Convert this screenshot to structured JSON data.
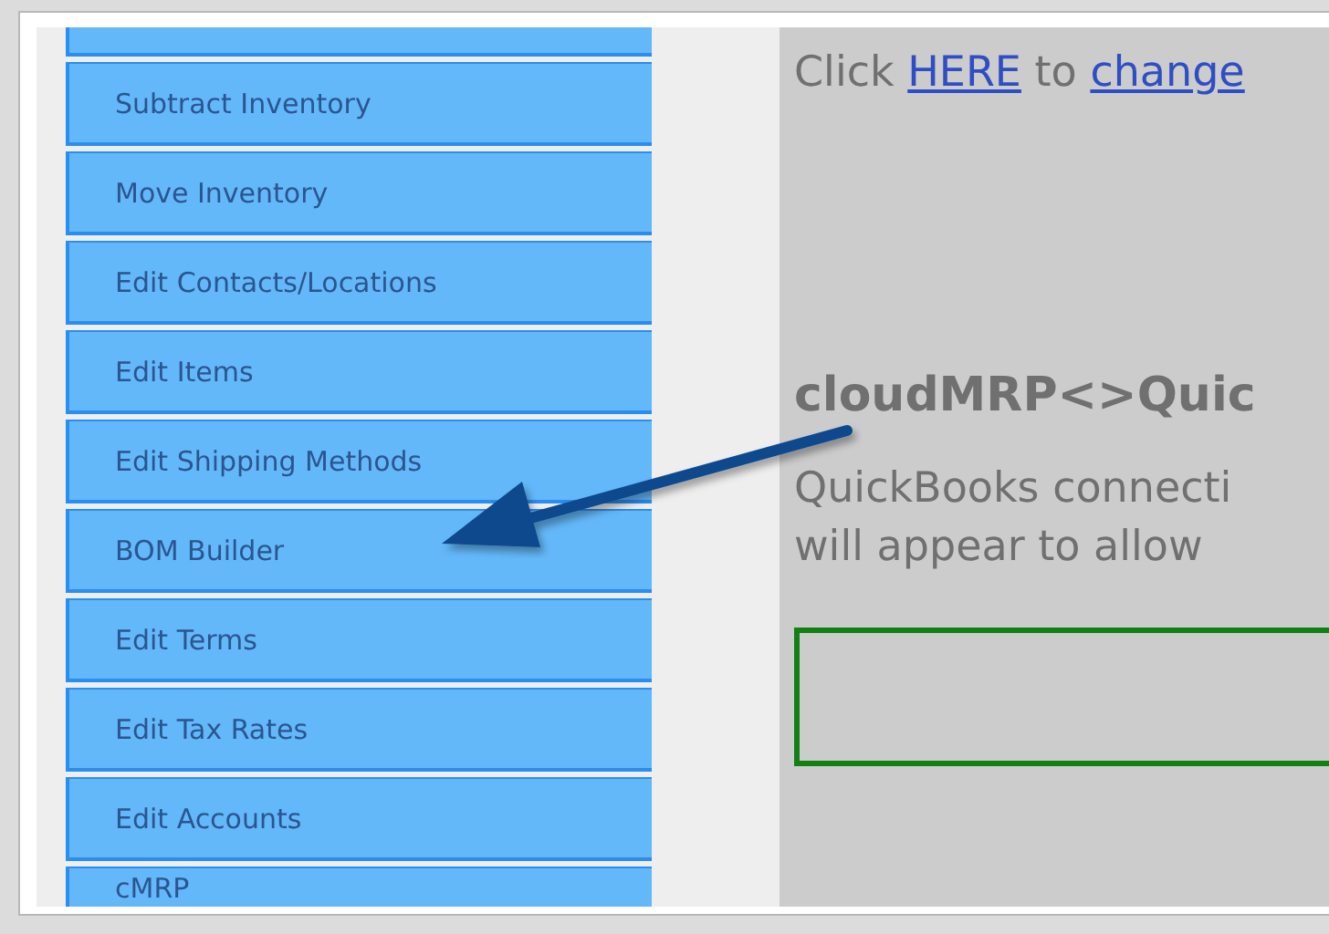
{
  "sidebar": {
    "items": [
      {
        "label": "Subtract Inventory"
      },
      {
        "label": "Move Inventory"
      },
      {
        "label": "Edit Contacts/Locations"
      },
      {
        "label": "Edit Items"
      },
      {
        "label": "Edit Shipping Methods"
      },
      {
        "label": "BOM Builder"
      },
      {
        "label": "Edit Terms"
      },
      {
        "label": "Edit Tax Rates"
      },
      {
        "label": "Edit Accounts"
      },
      {
        "label": "cMRP"
      }
    ]
  },
  "content": {
    "intro": [
      "Click",
      "HERE",
      "to",
      "change"
    ],
    "heading": "cloudMRP<>Quic",
    "paragraph": [
      "QuickBooks connecti",
      "will appear to allow"
    ]
  }
}
